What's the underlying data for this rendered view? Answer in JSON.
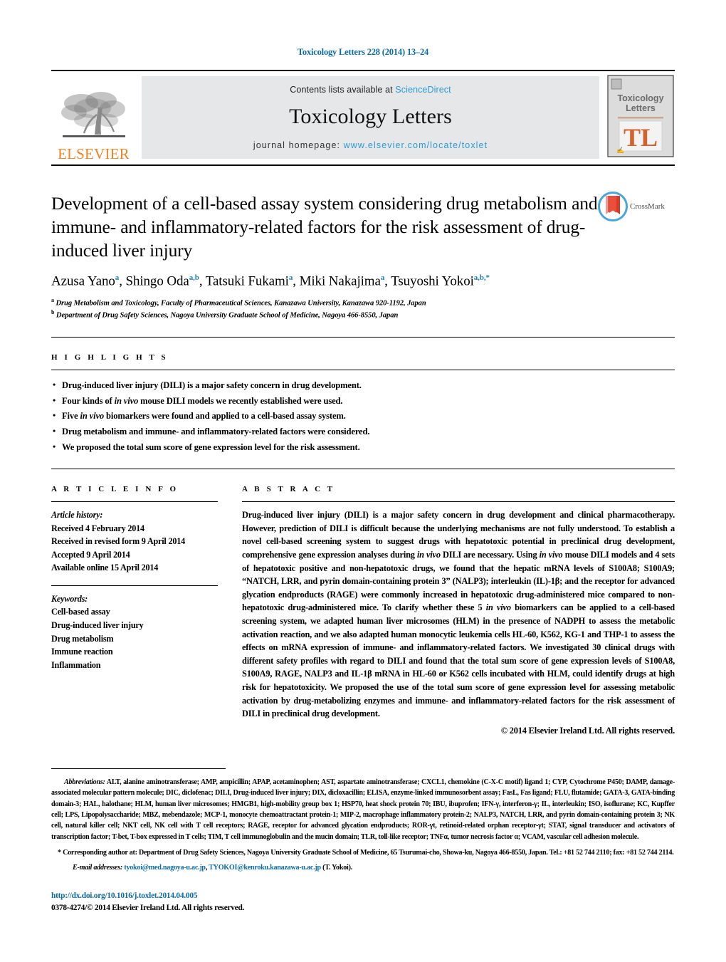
{
  "running_head": "Toxicology Letters 228 (2014) 13–24",
  "masthead": {
    "publisher_name": "ELSEVIER",
    "contents_prefix": "Contents lists available at ",
    "contents_link": "ScienceDirect",
    "journal_name": "Toxicology Letters",
    "homepage_prefix": "journal homepage: ",
    "homepage_url": "www.elsevier.com/locate/toxlet",
    "cover": {
      "line1": "Toxicology",
      "line2": "Letters",
      "logo_text": "TL"
    }
  },
  "article": {
    "title": "Development of a cell-based assay system considering drug metabolism and immune- and inflammatory-related factors for the risk assessment of drug-induced liver injury",
    "crossmark_label": "CrossMark",
    "authors_html": "Azusa Yano<sup>a</sup>, Shingo Oda<sup>a,b</sup>, Tatsuki Fukami<sup>a</sup>, Miki Nakajima<sup>a</sup>, Tsuyoshi Yokoi<sup>a,b,*</sup>",
    "affiliations": [
      "Drug Metabolism and Toxicology, Faculty of Pharmaceutical Sciences, Kanazawa University, Kanazawa 920-1192, Japan",
      "Department of Drug Safety Sciences, Nagoya University Graduate School of Medicine, Nagoya 466-8550, Japan"
    ],
    "affiliation_marks": [
      "a",
      "b"
    ]
  },
  "highlights": {
    "heading": "H I G H L I G H T S",
    "items": [
      "Drug-induced liver injury (DILI) is a major safety concern in drug development.",
      "Four kinds of <i>in vivo</i> mouse DILI models we recently established were used.",
      "Five <i>in vivo</i> biomarkers were found and applied to a cell-based assay system.",
      "Drug metabolism and immune- and inflammatory-related factors were considered.",
      "We proposed the total sum score of gene expression level for the risk assessment."
    ]
  },
  "article_info": {
    "heading": "A R T I C L E    I N F O",
    "history_label": "Article history:",
    "history": [
      "Received 4 February 2014",
      "Received in revised form 9 April 2014",
      "Accepted 9 April 2014",
      "Available online 15 April 2014"
    ],
    "keywords_label": "Keywords:",
    "keywords": [
      "Cell-based assay",
      "Drug-induced liver injury",
      "Drug metabolism",
      "Immune reaction",
      "Inflammation"
    ]
  },
  "abstract": {
    "heading": "A B S T R A C T",
    "text_html": "Drug-induced liver injury (DILI) is a major safety concern in drug development and clinical pharmacotherapy. However, prediction of DILI is difficult because the underlying mechanisms are not fully understood. To establish a novel cell-based screening system to suggest drugs with hepatotoxic potential in preclinical drug development, comprehensive gene expression analyses during <i>in vivo</i> DILI are necessary. Using <i>in vivo</i> mouse DILI models and 4 sets of hepatotoxic positive and non-hepatotoxic drugs, we found that the hepatic mRNA levels of S100A8; S100A9; “NATCH, LRR, and pyrin domain-containing protein 3” (NALP3); interleukin (IL)-1β; and the receptor for advanced glycation endproducts (RAGE) were commonly increased in hepatotoxic drug-administered mice compared to non-hepatotoxic drug-administered mice. To clarify whether these 5 <i>in vivo</i> biomarkers can be applied to a cell-based screening system, we adapted human liver microsomes (HLM) in the presence of NADPH to assess the metabolic activation reaction, and we also adapted human monocytic leukemia cells HL-60, K562, KG-1 and THP-1 to assess the effects on mRNA expression of immune- and inflammatory-related factors. We investigated 30 clinical drugs with different safety profiles with regard to DILI and found that the total sum score of gene expression levels of S100A8, S100A9, RAGE, NALP3 and IL-1β mRNA in HL-60 or K562 cells incubated with HLM, could identify drugs at high risk for hepatotoxicity. We proposed the use of the total sum score of gene expression level for assessing metabolic activation by drug-metabolizing enzymes and immune- and inflammatory-related factors for the risk assessment of DILI in preclinical drug development.",
    "copyright": "© 2014 Elsevier Ireland Ltd. All rights reserved."
  },
  "footnotes": {
    "abbreviations_label": "Abbreviations:",
    "abbreviations_text": "ALT, alanine aminotransferase; AMP, ampicillin; APAP, acetaminophen; AST, aspartate aminotransferase; CXCL1, chemokine (C-X-C motif) ligand 1; CYP, Cytochrome P450; DAMP, damage-associated molecular pattern molecule; DIC, diclofenac; DILI, Drug-induced liver injury; DIX, dicloxacillin; ELISA, enzyme-linked immunosorbent assay; FasL, Fas ligand; FLU, flutamide; GATA-3, GATA-binding domain-3; HAL, halothane; HLM, human liver microsomes; HMGB1, high-mobility group box 1; HSP70, heat shock protein 70; IBU, ibuprofen; IFN-γ, interferon-γ; IL, interleukin; ISO, isoflurane; KC, Kupffer cell; LPS, Lipopolysaccharide; MBZ, mebendazole; MCP-1, monocyte chemoattractant protein-1; MIP-2, macrophage inflammatory protein-2; NALP3, NATCH, LRR, and pyrin domain-containing protein 3; NK cell, natural killer cell; NKT cell, NK cell with T cell receptors; RAGE, receptor for advanced glycation endproducts; ROR-γt, retinoid-related orphan receptor-γt; STAT, signal transducer and activators of transcription factor; T-bet, T-box expressed in T cells; TIM, T cell immunoglobulin and the mucin domain; TLR, toll-like receptor; TNFα, tumor necrosis factor α; VCAM, vascular cell adhesion molecule.",
    "corresponding_mark": "*",
    "corresponding_text": "Corresponding author at: Department of Drug Safety Sciences, Nagoya University Graduate School of Medicine, 65 Tsurumai-cho, Showa-ku, Nagoya 466-8550, Japan. Tel.: +81 52 744 2110; fax: +81 52 744 2114.",
    "email_label": "E-mail addresses:",
    "email1": "tyokoi@med.nagoya-u.ac.jp",
    "email2": "TYOKOI@kenroku.kanazawa-u.ac.jp",
    "email_suffix": "(T. Yokoi)."
  },
  "doi": {
    "url": "http://dx.doi.org/10.1016/j.toxlet.2014.04.005",
    "issn_line": "0378-4274/© 2014 Elsevier Ireland Ltd. All rights reserved."
  },
  "colors": {
    "link_blue": "#0b6ca8",
    "sciencedirect_blue": "#2b9ad4",
    "elsevier_orange": "#f58220",
    "box_gray": "#e6e7e8"
  }
}
